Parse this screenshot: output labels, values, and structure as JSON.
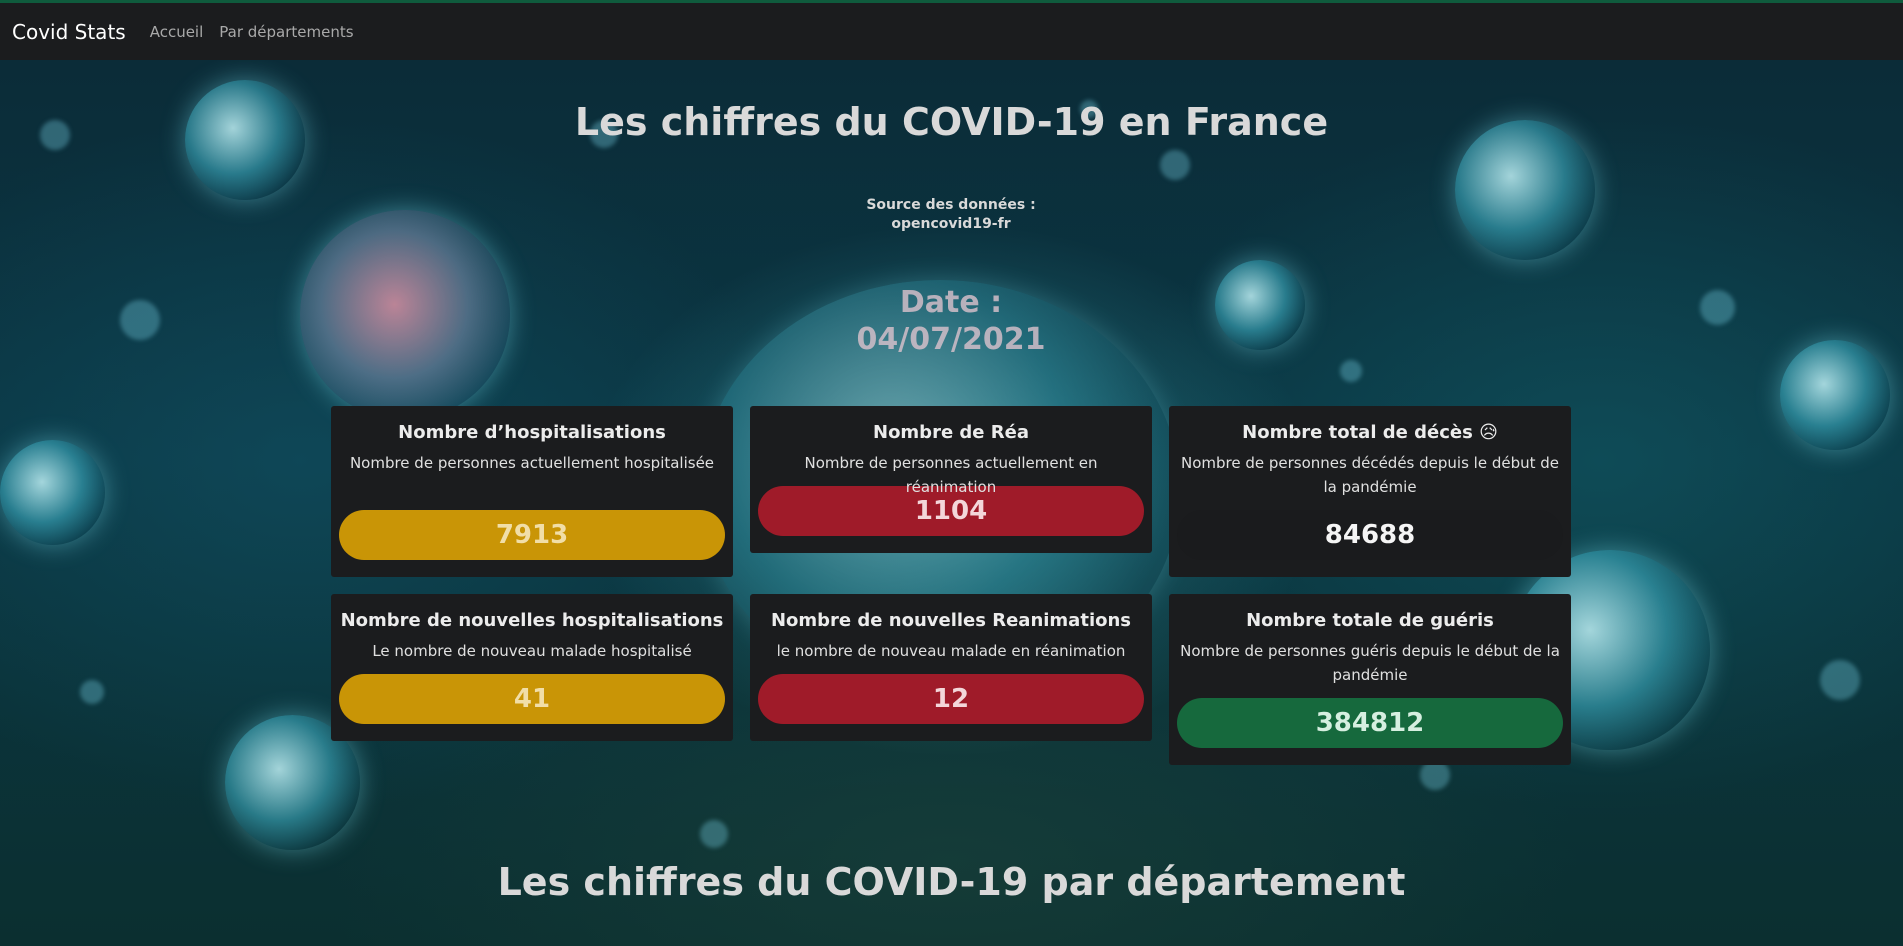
{
  "navbar": {
    "brand": "Covid Stats",
    "links": [
      "Accueil",
      "Par départements"
    ]
  },
  "header": {
    "title": "Les chiffres du COVID-19 en France",
    "source_label": "Source des données :",
    "source_name": "opencovid19-fr",
    "date_label": "Date :",
    "date_value": "04/07/2021"
  },
  "cards": [
    {
      "title": "Nombre d’hospitalisations",
      "text": "Nombre de personnes actuellement hospitalisée",
      "value": "7913",
      "color": "#c99506"
    },
    {
      "title": "Nombre de Réa",
      "text": "Nombre de personnes actuellement en réanimation",
      "value": "1104",
      "color": "#9f1b29"
    },
    {
      "title": "Nombre total de décès 😥",
      "text": "Nombre de personnes décédés depuis le début de la pandémie",
      "value": "84688",
      "color": "#1a1b1d"
    },
    {
      "title": "Nombre de nouvelles hospitalisations",
      "text": "Le nombre de nouveau malade hospitalisé",
      "value": "41",
      "color": "#c99506"
    },
    {
      "title": "Nombre de nouvelles Reanimations",
      "text": "le nombre de nouveau malade en réanimation",
      "value": "12",
      "color": "#9f1b29"
    },
    {
      "title": "Nombre totale de guéris",
      "text": "Nombre de personnes guéris depuis le début de la pandémie",
      "value": "384812",
      "color": "#16693d"
    }
  ],
  "section2": {
    "title": "Les chiffres du COVID-19 par département"
  }
}
